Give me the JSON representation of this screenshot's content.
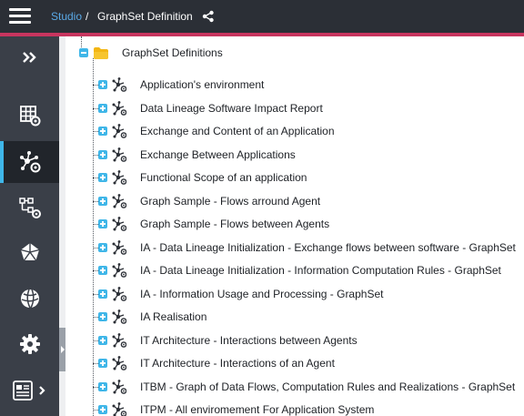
{
  "breadcrumb": {
    "root": "Studio",
    "separator": "/",
    "current": "GraphSet Definition"
  },
  "icons": {
    "menu": "hamburger-icon",
    "share": "share-icon",
    "rail": [
      "double-chevron-right-icon",
      "grid-gear-icon",
      "network-gear-icon",
      "flow-gear-icon",
      "pentagon-icon",
      "globe-icon",
      "gear-icon",
      "report-icon"
    ],
    "folder": "folder-icon",
    "node": "graph-node-icon"
  },
  "colors": {
    "accent": "#c8355f",
    "link": "#5aa9e6",
    "active_rail": "#3fb6e8",
    "folder": "#f3b614"
  },
  "tree": {
    "root": {
      "label": "GraphSet Definitions",
      "expanded": true
    },
    "items": [
      {
        "label": "Application's environment"
      },
      {
        "label": "Data Lineage Software Impact Report"
      },
      {
        "label": "Exchange and Content of an Application"
      },
      {
        "label": "Exchange Between Applications"
      },
      {
        "label": "Functional Scope of an application"
      },
      {
        "label": "Graph Sample - Flows arround Agent"
      },
      {
        "label": "Graph Sample - Flows between Agents"
      },
      {
        "label": "IA - Data Lineage Initialization - Exchange flows between software - GraphSet"
      },
      {
        "label": "IA - Data Lineage Initialization - Information Computation Rules - GraphSet"
      },
      {
        "label": "IA - Information Usage and Processing - GraphSet"
      },
      {
        "label": "IA Realisation"
      },
      {
        "label": "IT Architecture - Interactions between Agents"
      },
      {
        "label": "IT Architecture - Interactions of an Agent"
      },
      {
        "label": "ITBM - Graph of Data Flows, Computation Rules and Realizations - GraphSet"
      },
      {
        "label": "ITPM -  All enviromement For Application System"
      }
    ]
  }
}
